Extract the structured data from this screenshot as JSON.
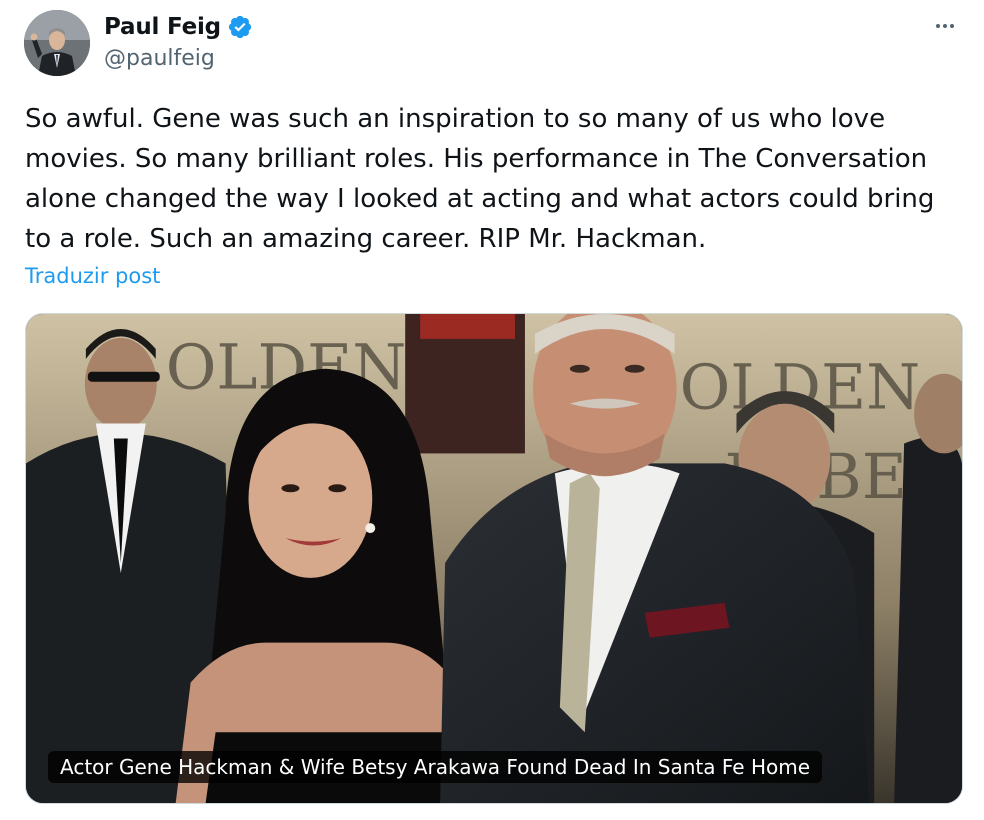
{
  "author": {
    "display_name": "Paul Feig",
    "handle": "@paulfeig",
    "verified": true,
    "verified_color": "#1d9bf0"
  },
  "menu": {
    "icon": "more-horizontal-icon"
  },
  "post": {
    "text": "So awful. Gene was such an inspiration to so many of us who love movies. So many brilliant roles. His performance in The Conversation alone changed the way I looked at acting and what actors could bring to a role. Such an amazing career. RIP Mr. Hackman.",
    "translate_label": "Traduzir post"
  },
  "media": {
    "caption": "Actor Gene Hackman & Wife Betsy Arakawa Found Dead In Santa Fe Home"
  },
  "colors": {
    "text": "#0f1419",
    "muted": "#536471",
    "link": "#1d9bf0"
  }
}
